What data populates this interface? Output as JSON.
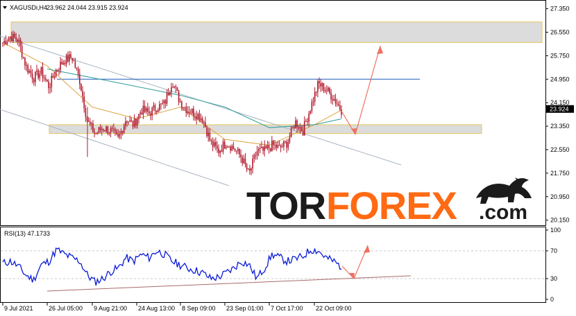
{
  "header": {
    "symbol": "XAGUSDi,H4",
    "ohlc": "23.962 24.044 23.915 23.924",
    "dropdown_icon": "triangle-down-icon"
  },
  "rsi_header": {
    "label": "RSI(13) 47.1733"
  },
  "price_badge": {
    "value": "23.924"
  },
  "logo": {
    "part1": "TOR",
    "part2": "FOREX",
    "part3": ".com",
    "icon": "bull-icon"
  },
  "colors": {
    "candle": "#b0172a",
    "ma_fast": "#e0a440",
    "ma_slow": "#2f9e98",
    "rsi_line": "#0a1bd6",
    "level_line": "#1c5bb8",
    "zone_fill": "#dcdcdc",
    "zone_border": "#e5c65a",
    "channel": "#a8b5c2",
    "arrow": "#f07060",
    "rsi_trend": "#a86a6a",
    "logo_dark": "#1b1b1b",
    "logo_orange": "#ff6a13"
  },
  "chart_data": [
    {
      "type": "candlestick",
      "series": [
        {
          "name": "XAGUSDi,H4",
          "x": [
            "9 Jul 2021",
            "12 Jul",
            "14 Jul",
            "16 Jul",
            "19 Jul",
            "21 Jul",
            "23 Jul",
            "26 Jul 2021",
            "28 Jul",
            "30 Jul",
            "2 Aug",
            "4 Aug",
            "6 Aug",
            "9 Aug 2021",
            "11 Aug",
            "13 Aug",
            "16 Aug",
            "18 Aug",
            "20 Aug",
            "23 Aug",
            "24 Aug 2021",
            "26 Aug",
            "30 Aug",
            "1 Sep",
            "3 Sep",
            "6 Sep",
            "8 Sep 2021",
            "10 Sep",
            "13 Sep",
            "15 Sep",
            "17 Sep",
            "20 Sep",
            "23 Sep 2021",
            "27 Sep",
            "29 Sep",
            "1 Oct",
            "4 Oct",
            "7 Oct 2021",
            "11 Oct",
            "13 Oct",
            "15 Oct",
            "18 Oct",
            "20 Oct",
            "22 Oct 2021",
            "25 Oct"
          ],
          "y": [
            26.2,
            26.4,
            26.3,
            25.4,
            25.0,
            25.2,
            24.7,
            25.3,
            25.6,
            25.7,
            24.9,
            23.5,
            23.1,
            23.3,
            23.2,
            22.9,
            23.6,
            23.4,
            23.9,
            23.8,
            24.0,
            24.1,
            24.9,
            24.2,
            23.9,
            23.8,
            23.6,
            22.8,
            22.5,
            22.8,
            22.6,
            22.3,
            21.7,
            22.5,
            22.5,
            22.7,
            22.6,
            22.8,
            23.5,
            23.2,
            24.0,
            24.8,
            24.6,
            24.3,
            23.9
          ],
          "high": 26.5,
          "low": 21.75
        },
        {
          "name": "MA fast",
          "x": [
            "9 Jul 2021",
            "26 Jul 2021",
            "9 Aug 2021",
            "24 Aug 2021",
            "8 Sep 2021",
            "23 Sep 2021",
            "7 Oct 2021",
            "22 Oct 2021",
            "25 Oct"
          ],
          "y": [
            26.2,
            25.4,
            24.0,
            23.6,
            24.0,
            22.9,
            22.7,
            23.4,
            23.9
          ]
        },
        {
          "name": "MA slow",
          "x": [
            "26 Jul 2021",
            "9 Aug 2021",
            "24 Aug 2021",
            "8 Sep 2021",
            "23 Sep 2021",
            "7 Oct 2021",
            "22 Oct 2021",
            "25 Oct"
          ],
          "y": [
            25.3,
            25.0,
            24.7,
            24.4,
            24.0,
            23.3,
            23.4,
            23.6
          ]
        }
      ],
      "levels": [
        24.95
      ],
      "zones": [
        [
          26.2,
          26.9
        ],
        [
          23.1,
          23.4
        ]
      ],
      "y_ticks": [
        "27.350",
        "26.550",
        "25.750",
        "24.950",
        "24.150",
        "23.350",
        "22.550",
        "21.750",
        "20.950",
        "20.150"
      ],
      "ylim": [
        20.0,
        27.6
      ],
      "x_ticks": [
        "9 Jul 2021",
        "26 Jul 05:00",
        "9 Aug 21:00",
        "24 Aug 13:00",
        "8 Sep 09:00",
        "23 Sep 01:00",
        "7 Oct 17:00",
        "22 Oct 09:00"
      ],
      "last_price": 23.924,
      "grid": false
    },
    {
      "type": "line",
      "series": [
        {
          "name": "RSI(13)",
          "y": [
            52,
            55,
            48,
            35,
            28,
            50,
            55,
            72,
            65,
            60,
            55,
            35,
            25,
            30,
            40,
            45,
            60,
            55,
            65,
            60,
            70,
            65,
            55,
            50,
            45,
            42,
            38,
            30,
            32,
            38,
            45,
            55,
            50,
            30,
            45,
            65,
            60,
            55,
            58,
            62,
            72,
            70,
            60,
            55,
            47
          ]
        }
      ],
      "y_ticks": [
        "100",
        "70",
        "30",
        "0"
      ],
      "ylim": [
        0,
        100
      ]
    }
  ]
}
